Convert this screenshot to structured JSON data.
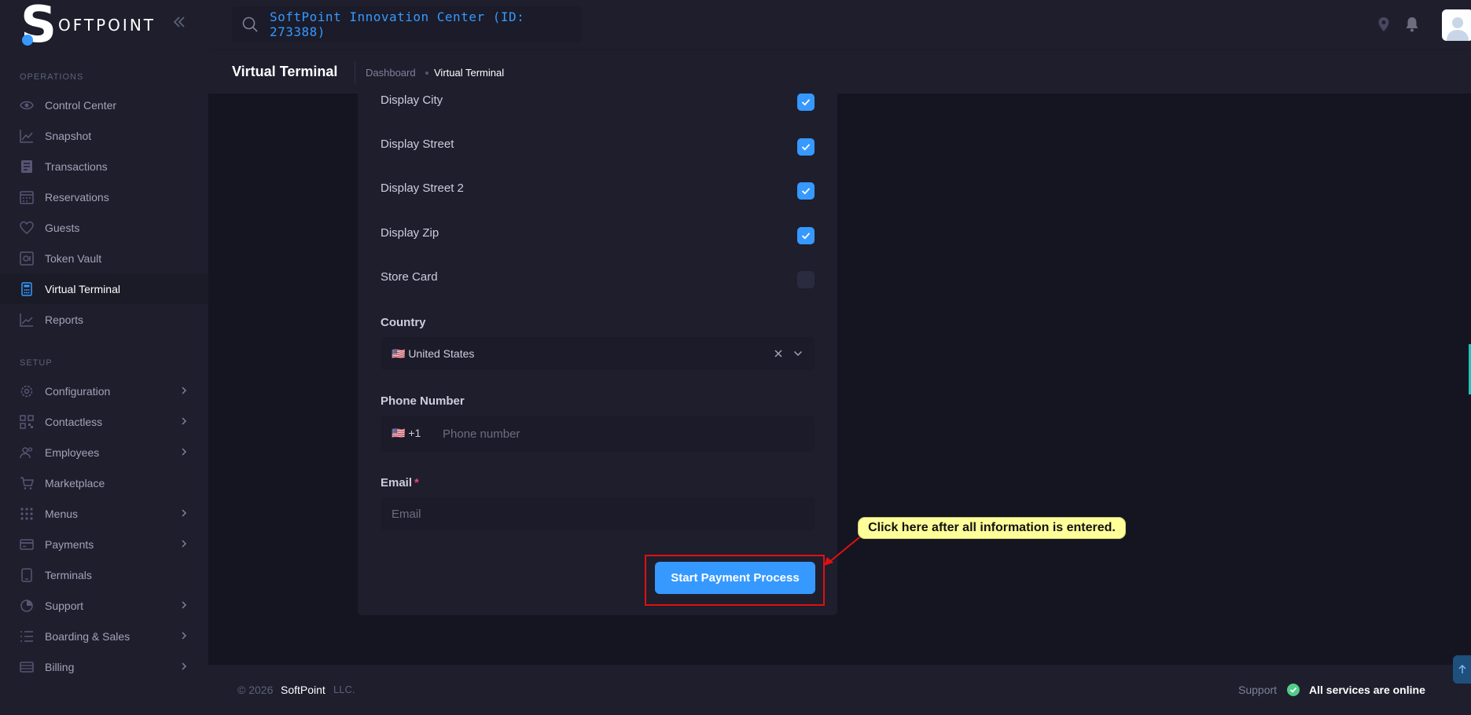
{
  "app": {
    "logo_letter": "S",
    "logo_text": "OFTPOINT",
    "search_text": "SoftPoint Innovation Center (ID: 273388)"
  },
  "sidebar": {
    "sections": [
      {
        "title": "OPERATIONS"
      },
      {
        "title": "SETUP"
      }
    ],
    "items": [
      {
        "label": "Control Center",
        "icon": "eye-icon"
      },
      {
        "label": "Snapshot",
        "icon": "chart-line-icon"
      },
      {
        "label": "Transactions",
        "icon": "list-icon"
      },
      {
        "label": "Reservations",
        "icon": "calendar-icon"
      },
      {
        "label": "Guests",
        "icon": "heart-icon"
      },
      {
        "label": "Token Vault",
        "icon": "vault-icon"
      },
      {
        "label": "Virtual Terminal",
        "icon": "calculator-icon",
        "active": true
      },
      {
        "label": "Reports",
        "icon": "chart-line-icon"
      },
      {
        "label": "Configuration",
        "icon": "gear-icon"
      },
      {
        "label": "Contactless",
        "icon": "qr-icon"
      },
      {
        "label": "Employees",
        "icon": "users-icon"
      },
      {
        "label": "Marketplace",
        "icon": "cart-icon"
      },
      {
        "label": "Menus",
        "icon": "grid-icon"
      },
      {
        "label": "Payments",
        "icon": "credit-card-icon"
      },
      {
        "label": "Terminals",
        "icon": "tablet-icon"
      },
      {
        "label": "Support",
        "icon": "support-icon"
      },
      {
        "label": "Boarding & Sales",
        "icon": "checklist-icon"
      },
      {
        "label": "Billing",
        "icon": "billing-icon"
      }
    ]
  },
  "toolbar": {
    "page_title": "Virtual Terminal",
    "breadcrumb": [
      "Dashboard",
      "Virtual Terminal"
    ]
  },
  "form": {
    "toggles": [
      {
        "label": "Display City",
        "checked": true
      },
      {
        "label": "Display Street",
        "checked": true
      },
      {
        "label": "Display Street 2",
        "checked": true
      },
      {
        "label": "Display Zip",
        "checked": true
      },
      {
        "label": "Store Card",
        "checked": false
      }
    ],
    "country_label": "Country",
    "country_value": "🇺🇸 United States",
    "phone_label": "Phone Number",
    "phone_code": "🇺🇸 +1",
    "phone_placeholder": "Phone number",
    "email_label": "Email",
    "email_required": "*",
    "email_placeholder": "Email",
    "submit_label": "Start Payment Process"
  },
  "annotation": {
    "callout_text": "Click here after all information is entered."
  },
  "footer": {
    "copyright": "© 2026",
    "brand": "SoftPoint",
    "suffix": "LLC.",
    "support_label": "Support",
    "status_text": "All services are online"
  },
  "colors": {
    "accent": "#3699ff",
    "success": "#50cd89",
    "danger": "#f1416c",
    "callout_bg": "#ffff99",
    "highlight_border": "#e01010"
  }
}
